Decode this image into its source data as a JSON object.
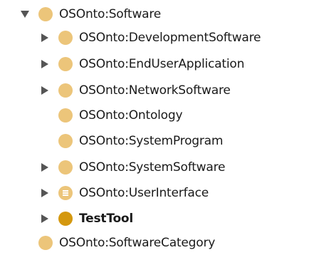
{
  "tree": {
    "root": {
      "label": "OSOnto:Software",
      "expanded": true,
      "children": [
        {
          "label": "OSOnto:DevelopmentSoftware",
          "has_children": true
        },
        {
          "label": "OSOnto:EndUserApplication",
          "has_children": true
        },
        {
          "label": "OSOnto:NetworkSoftware",
          "has_children": true
        },
        {
          "label": "OSOnto:Ontology",
          "has_children": false
        },
        {
          "label": "OSOnto:SystemProgram",
          "has_children": false
        },
        {
          "label": "OSOnto:SystemSoftware",
          "has_children": true
        },
        {
          "label": "OSOnto:UserInterface",
          "has_children": true,
          "icon": "equivalent-class-icon"
        },
        {
          "label": "TestTool",
          "has_children": true,
          "selected_style": "bold",
          "icon": "class-icon-dark"
        }
      ]
    },
    "sibling": {
      "label": "OSOnto:SoftwareCategory"
    }
  },
  "colors": {
    "class_icon": "#ecc57a",
    "class_icon_dark": "#d4980f",
    "toggle": "#555555",
    "text": "#1a1a1a"
  }
}
